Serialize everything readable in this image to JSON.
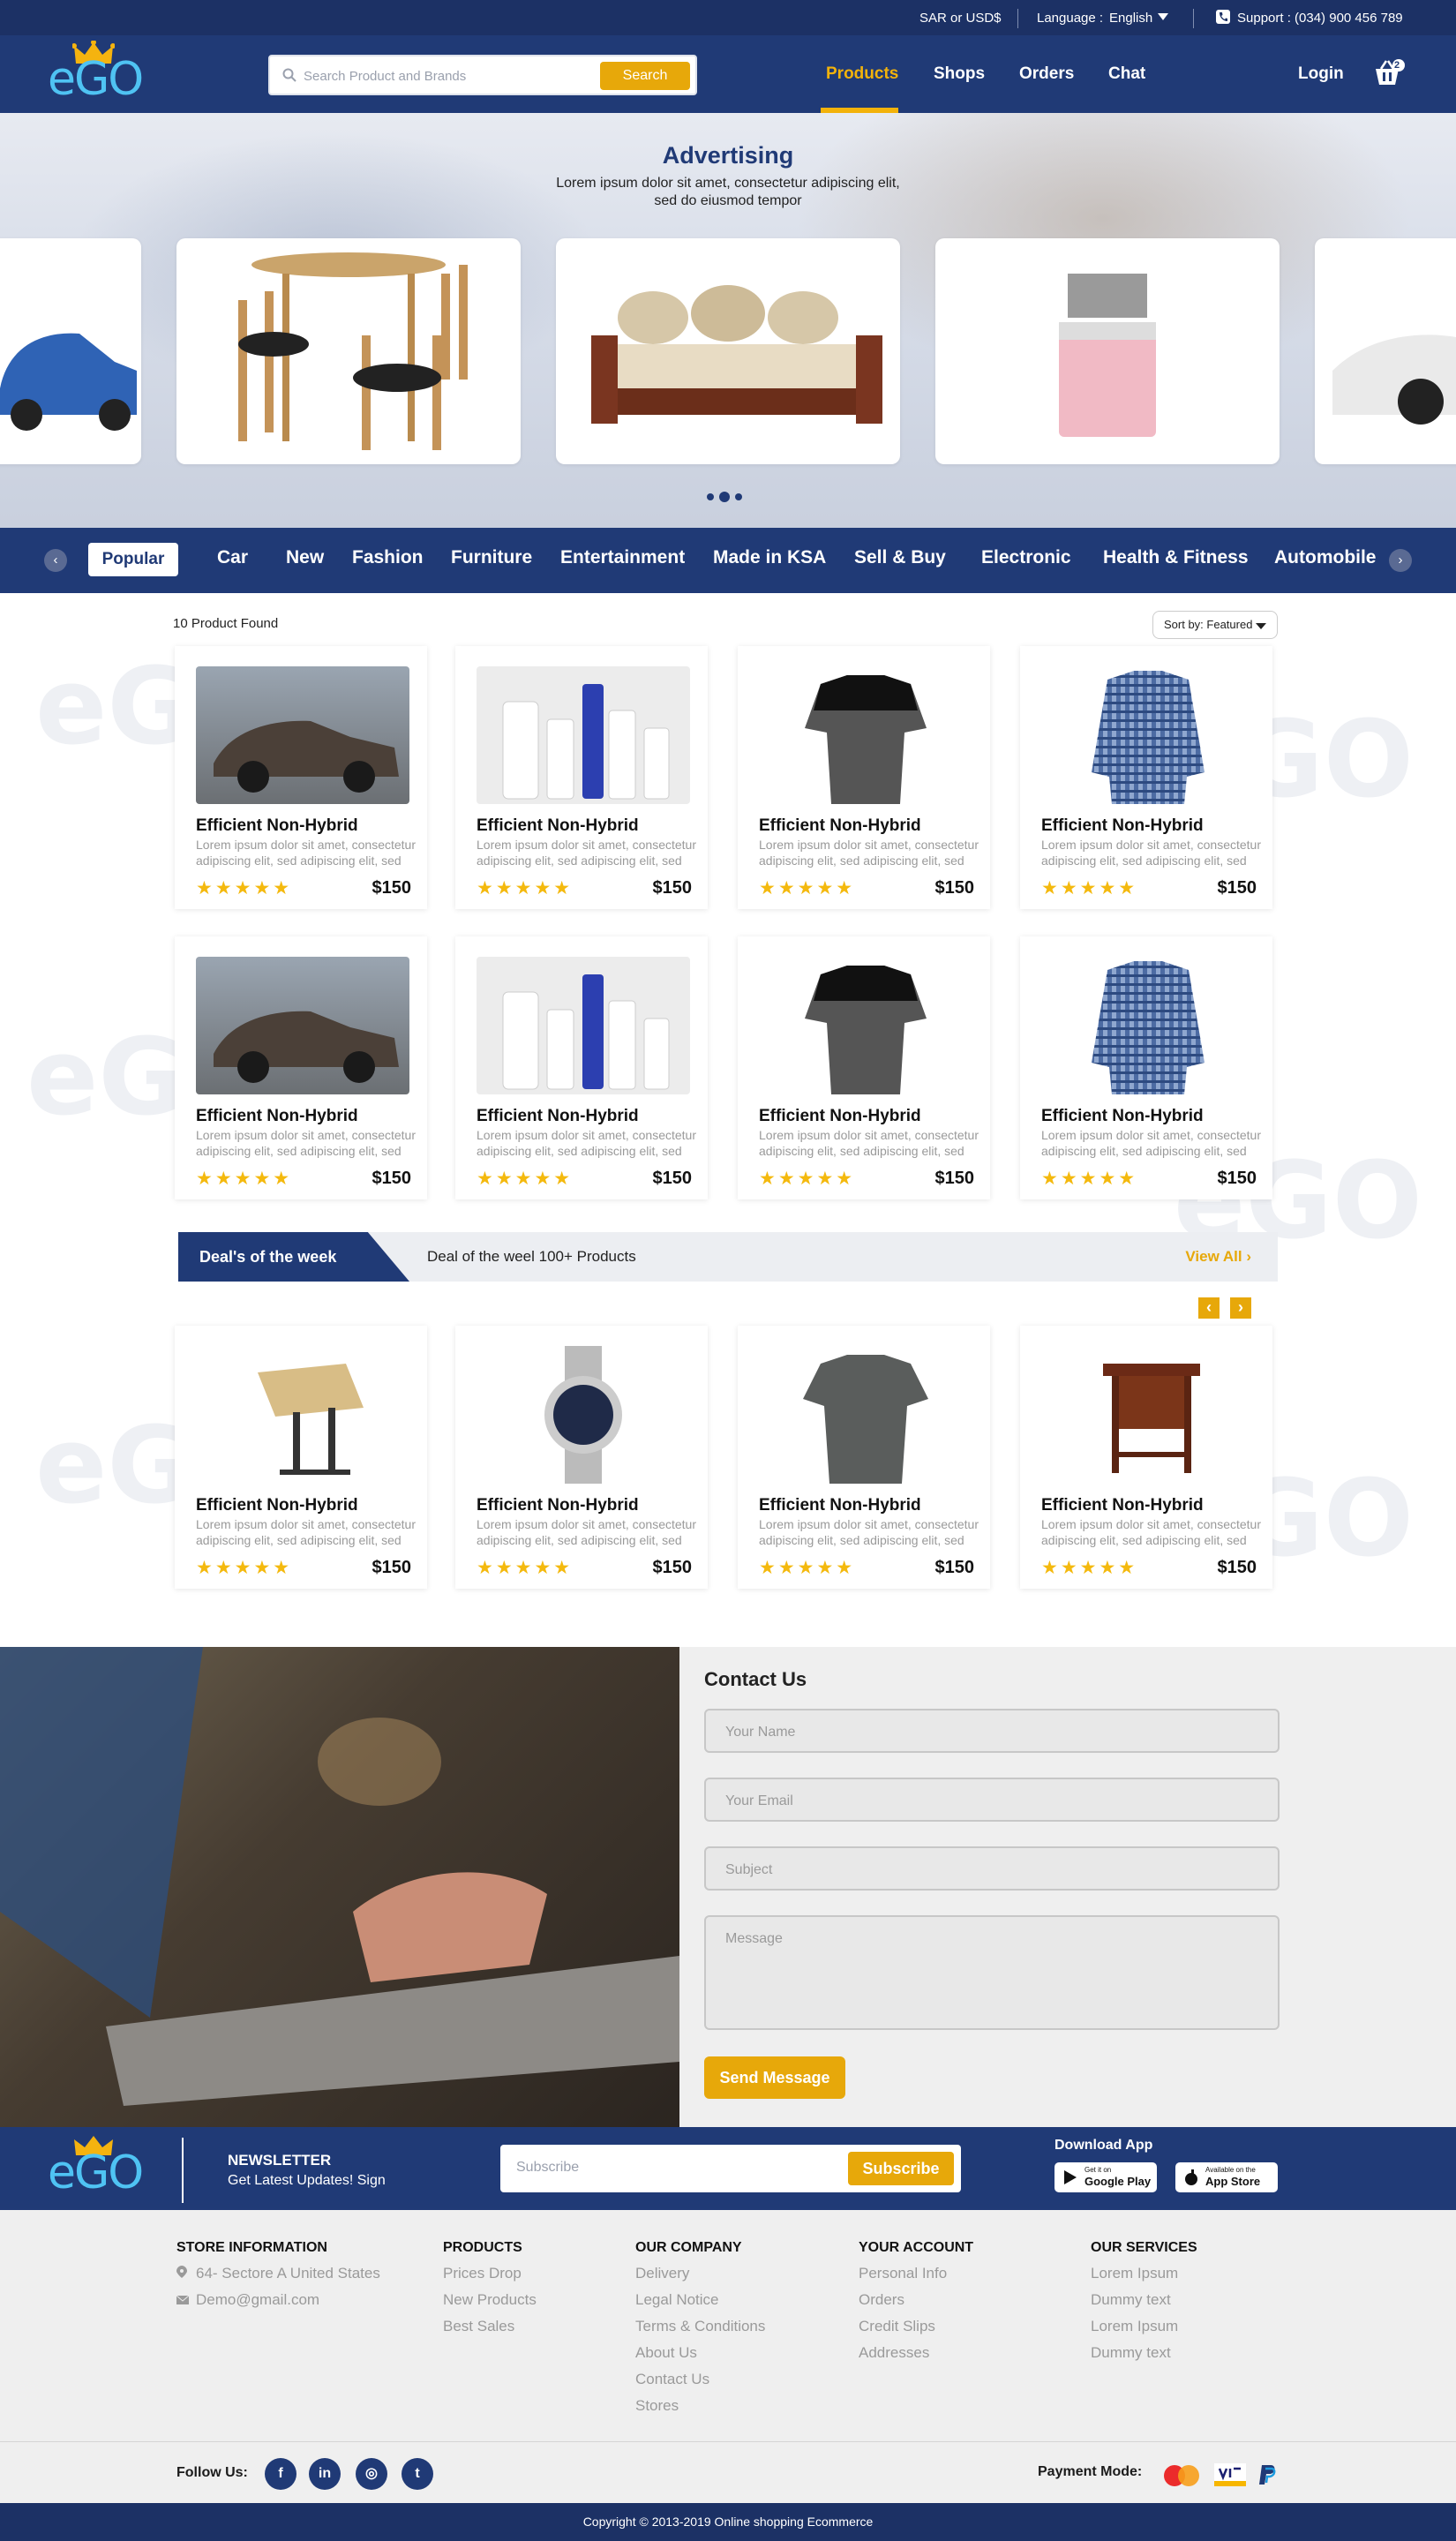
{
  "topbar": {
    "currency": "SAR or USD$",
    "language_label": "Language :",
    "language_value": "English",
    "support": "Support : (034) 900 456 789"
  },
  "header": {
    "logo": "eGO",
    "search_placeholder": "Search Product and Brands",
    "search_button": "Search",
    "nav": [
      "Products",
      "Shops",
      "Orders",
      "Chat"
    ],
    "login": "Login",
    "cart_count": "2"
  },
  "hero": {
    "title": "Advertising",
    "subtitle": "Lorem ipsum dolor sit amet, consectetur adipiscing elit, sed do eiusmod tempor"
  },
  "categories": [
    "Popular",
    "Car",
    "New",
    "Fashion",
    "Furniture",
    "Entertainment",
    "Made in KSA",
    "Sell & Buy",
    "Electronic",
    "Health & Fitness",
    "Automobile"
  ],
  "listing": {
    "count_text": "10 Product Found",
    "sort_label": "Sort by: Featured"
  },
  "product": {
    "name": "Efficient Non-Hybrid",
    "desc": "Lorem ipsum dolor sit amet, consectetur adipiscing elit, sed adipiscing elit, sed",
    "price": "$150",
    "rating": 5
  },
  "deals": {
    "title": "Deal's of the week",
    "subtitle": "Deal of the weel 100+ Products",
    "view_all": "View All"
  },
  "contact": {
    "title": "Contact Us",
    "name_ph": "Your Name",
    "email_ph": "Your Email",
    "subject_ph": "Subject",
    "message_ph": "Message",
    "send": "Send Message"
  },
  "newsletter": {
    "title": "NEWSLETTER",
    "subtitle": "Get Latest Updates! Sign",
    "placeholder": "Subscribe",
    "button": "Subscribe",
    "download": "Download App",
    "google_small": "Get it on",
    "google_big": "Google Play",
    "apple_small": "Available on the",
    "apple_big": "App Store"
  },
  "footer": {
    "store": {
      "title": "STORE INFORMATION",
      "address": "64- Sectore  A  United States",
      "email": "Demo@gmail.com"
    },
    "products": {
      "title": "PRODUCTS",
      "links": [
        "Prices Drop",
        "New Products",
        "Best Sales"
      ]
    },
    "company": {
      "title": "OUR COMPANY",
      "links": [
        "Delivery",
        "Legal Notice",
        "Terms & Conditions",
        "About Us",
        "Contact Us",
        "Stores"
      ]
    },
    "account": {
      "title": "YOUR ACCOUNT",
      "links": [
        "Personal Info",
        "Orders",
        "Credit Slips",
        "Addresses"
      ]
    },
    "services": {
      "title": "OUR SERVICES",
      "links": [
        "Lorem Ipsum",
        "Dummy text",
        "Lorem Ipsum",
        "Dummy text"
      ]
    },
    "follow": "Follow Us:",
    "payment": "Payment Mode:",
    "copyright": "Copyright © 2013-2019 Online shopping Ecommerce"
  },
  "colors": {
    "navy": "#203a76",
    "accent": "#e7a80a",
    "light_blue": "#4fc3f3"
  }
}
